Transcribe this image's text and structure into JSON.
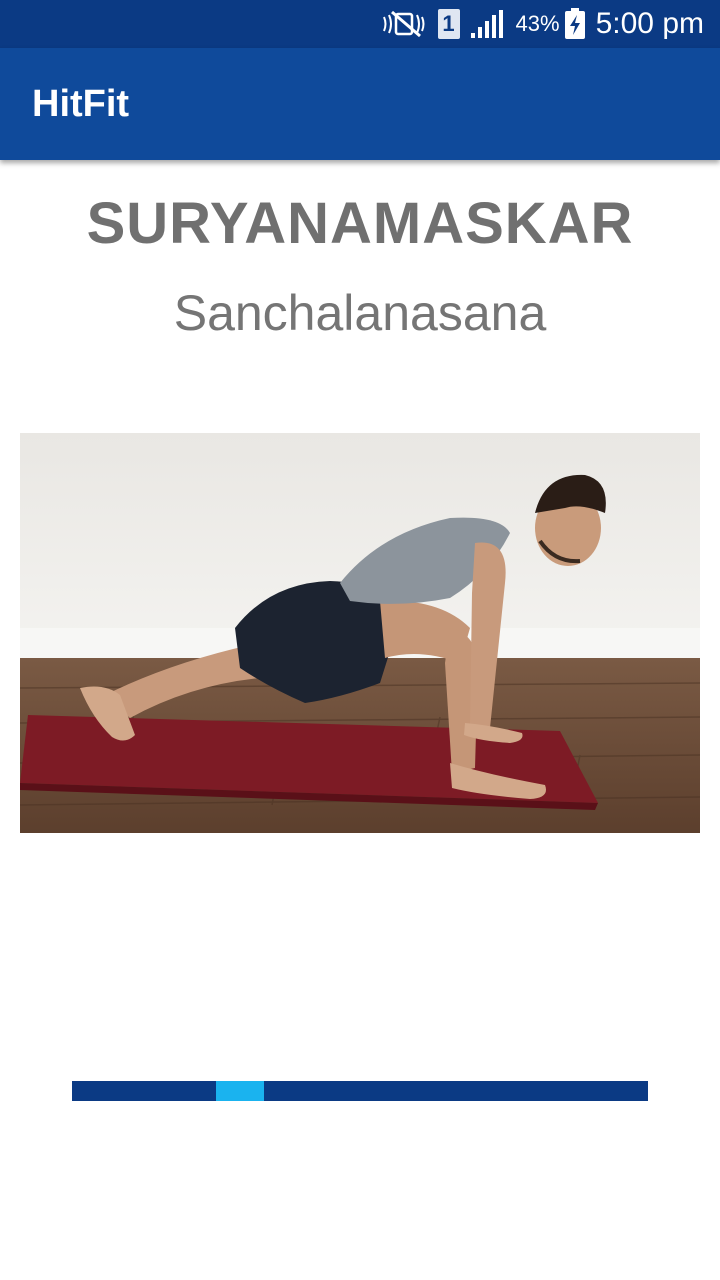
{
  "status_bar": {
    "icons": [
      "mute-vibrate-icon",
      "sim-1-icon",
      "signal-icon",
      "battery-charging-icon"
    ],
    "sim_label": "1",
    "battery_percent": "43%",
    "time": "5:00 pm"
  },
  "app_bar": {
    "title": "HitFit",
    "color": "#0f4a9b"
  },
  "exercise": {
    "title": "SURYANAMASKAR",
    "pose": "Sanchalanasana",
    "image_icon": "person-lunge-on-yoga-mat-photo"
  },
  "progress": {
    "step": 4,
    "total_steps": 12,
    "track_color": "#0b3a84",
    "active_color": "#1ab3ef"
  }
}
